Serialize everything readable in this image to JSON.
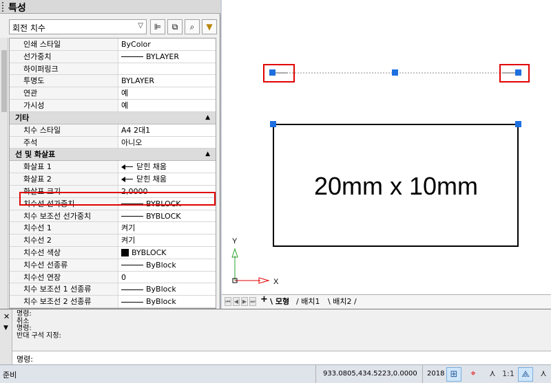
{
  "palette": {
    "title": "특성",
    "object_type": "회전 치수",
    "grid": {
      "top_rows": [
        {
          "key": "인쇄 스타일",
          "value": "ByColor"
        },
        {
          "key": "선가중치",
          "value": "BYLAYER",
          "glyph": "line"
        },
        {
          "key": "하이퍼링크",
          "value": ""
        },
        {
          "key": "투명도",
          "value": "BYLAYER"
        },
        {
          "key": "연관",
          "value": "예"
        },
        {
          "key": "가시성",
          "value": "예"
        }
      ],
      "misc_title": "기타",
      "misc_rows": [
        {
          "key": "치수 스타일",
          "value": "A4 2대1"
        },
        {
          "key": "주석",
          "value": "아니오"
        }
      ],
      "lines_title": "선 및 화살표",
      "lines_rows": [
        {
          "key": "화살표 1",
          "value": "닫힌 채움",
          "glyph": "arrow"
        },
        {
          "key": "화살표 2",
          "value": "닫힌 채움",
          "glyph": "arrow"
        },
        {
          "key": "화살표 크기",
          "value": "2,0000"
        },
        {
          "key": "치수선 선가중치",
          "value": "BYBLOCK",
          "glyph": "line"
        },
        {
          "key": "치수 보조선 선가중치",
          "value": "BYBLOCK",
          "glyph": "line"
        },
        {
          "key": "치수선 1",
          "value": "켜기"
        },
        {
          "key": "치수선 2",
          "value": "켜기"
        },
        {
          "key": "치수선 색상",
          "value": "BYBLOCK",
          "glyph": "swatch"
        },
        {
          "key": "치수선 선종류",
          "value": "ByBlock",
          "glyph": "line"
        },
        {
          "key": "치수선 연장",
          "value": "0"
        },
        {
          "key": "치수 보조선 1 선종류",
          "value": "ByBlock",
          "glyph": "line"
        },
        {
          "key": "치수 보조선 2 선종류",
          "value": "ByBlock",
          "glyph": "line"
        }
      ]
    }
  },
  "canvas": {
    "rect_label": "20mm x 10mm",
    "ucs_y": "Y",
    "ucs_x": "X"
  },
  "tabs": {
    "add": "+",
    "model": "모형",
    "layout1": "배치1",
    "layout2": "배치2"
  },
  "command": {
    "history": [
      "명령:",
      "취소",
      "명령:",
      "반대 구석 지정:"
    ],
    "prompt": "명령:"
  },
  "status": {
    "ready": "준비",
    "coords": "933.0805,434.5223,0.0000",
    "year": "2018",
    "scale": "1:1"
  },
  "colors": {
    "grip": "#1e6fe0",
    "highlight": "#e00000",
    "ucs": "#2aa02a"
  }
}
